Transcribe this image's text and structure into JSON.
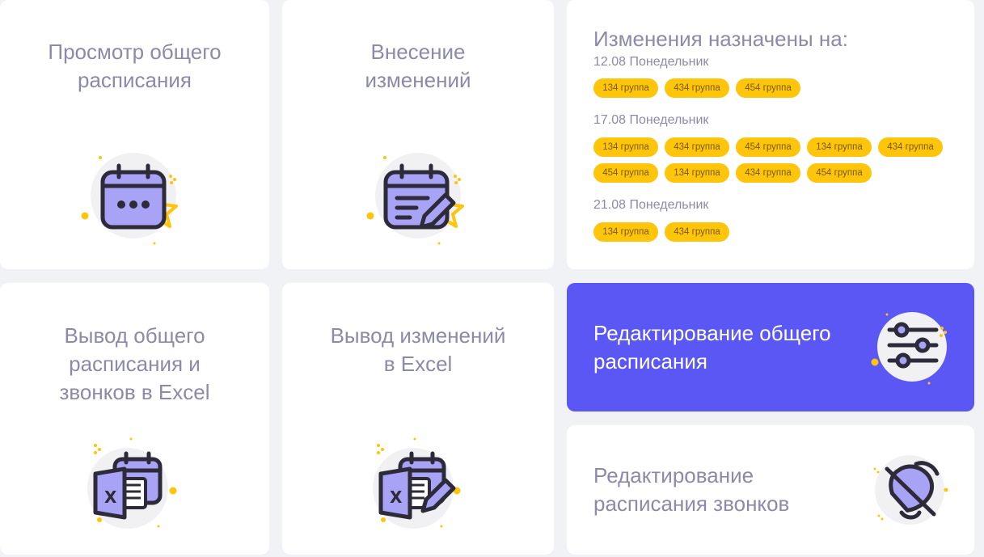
{
  "cards": {
    "view_schedule": {
      "title": "Просмотр общего\nрасписания",
      "icon": "calendar-dots-icon"
    },
    "make_changes": {
      "title": "Внесение\nизменений",
      "icon": "calendar-edit-icon"
    },
    "export_schedule": {
      "title": "Вывод общего\nрасписания и\nзвонков в Excel",
      "icon": "excel-calendar-icon"
    },
    "export_changes": {
      "title": "Вывод изменений\nв Excel",
      "icon": "excel-calendar-edit-icon"
    },
    "edit_schedule": {
      "title": "Редактирование общего\nрасписания",
      "icon": "sliders-icon"
    },
    "edit_bells": {
      "title": "Редактирование\nрасписания звонков",
      "icon": "bell-off-icon"
    }
  },
  "changes": {
    "title": "Изменения назначены на:",
    "days": [
      {
        "label": "12.08 Понедельник",
        "groups": [
          "134 группа",
          "434 группа",
          "454 группа"
        ]
      },
      {
        "label": "17.08 Понедельник",
        "groups": [
          "134 группа",
          "434 группа",
          "454 группа",
          "134 группа",
          "434 группа",
          "454 группа",
          "134 группа",
          "434 группа",
          "454 группа"
        ]
      },
      {
        "label": "21.08 Понедельник",
        "groups": [
          "134 группа",
          "434 группа"
        ]
      }
    ]
  },
  "colors": {
    "accent": "#5b57f5",
    "chip": "#ffc50a",
    "icon_fill": "#a8a3f5",
    "icon_stroke": "#2d2b3a",
    "text_muted": "#8c8aa8"
  }
}
